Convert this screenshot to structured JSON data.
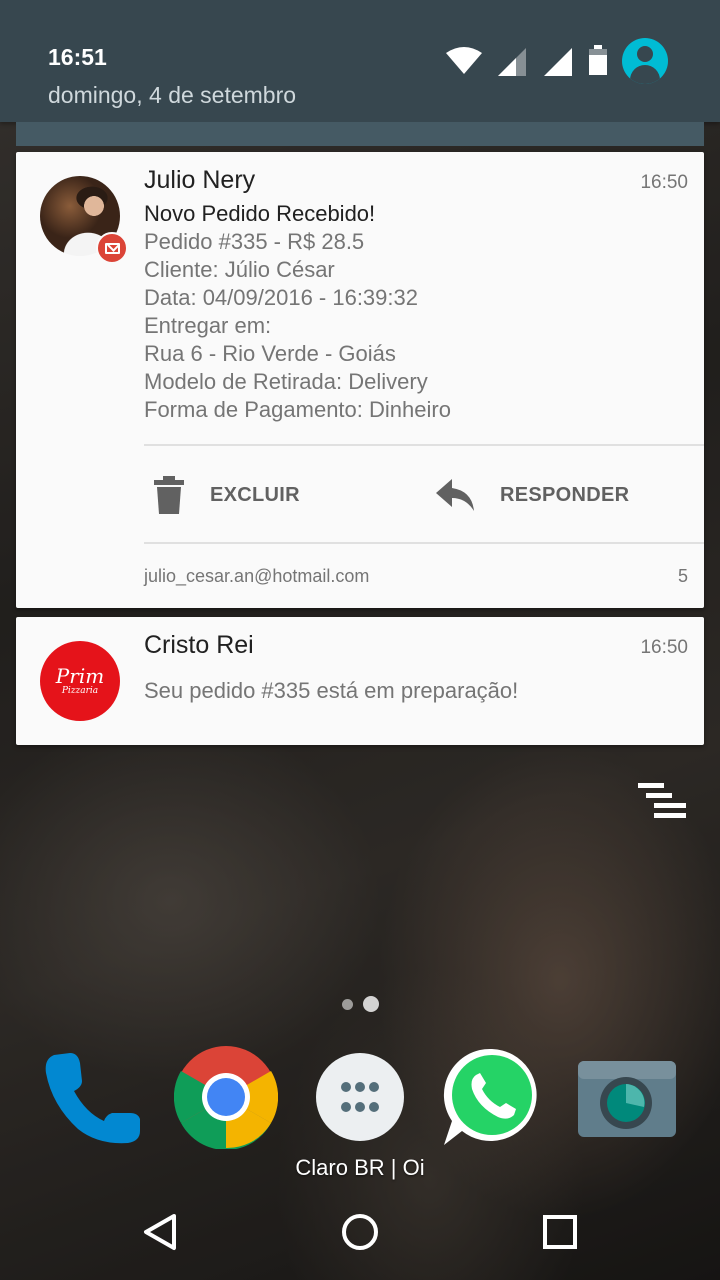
{
  "status_bar": {
    "time": "16:51",
    "date": "domingo, 4 de setembro",
    "icons": [
      "wifi-icon",
      "signal-icon",
      "signal-icon",
      "battery-icon",
      "account-icon"
    ]
  },
  "notifications": [
    {
      "app": "Gmail",
      "title": "Julio Nery",
      "time": "16:50",
      "lines": [
        "Novo Pedido Recebido!",
        "Pedido #335 - R$ 28.5",
        "Cliente: Júlio César",
        "Data: 04/09/2016 - 16:39:32",
        "Entregar em:",
        "Rua 6 - Rio Verde - Goiás",
        "Modelo de Retirada: Delivery",
        "Forma de Pagamento: Dinheiro"
      ],
      "actions": [
        {
          "label": "EXCLUIR",
          "icon": "trash-icon"
        },
        {
          "label": "RESPONDER",
          "icon": "reply-icon"
        }
      ],
      "account": "julio_cesar.an@hotmail.com",
      "count": "5"
    },
    {
      "title": "Cristo Rei",
      "time": "16:50",
      "text": "Seu pedido #335 está em preparação!",
      "logo_text": "Prim",
      "logo_subtext": "Pizzaria"
    }
  ],
  "home": {
    "dock_apps": [
      "Telefone",
      "Chrome",
      "Apps",
      "WhatsApp",
      "Câmera"
    ],
    "carrier": "Claro BR | Oi"
  },
  "colors": {
    "shade": "#37474f",
    "gmail_red": "#db4437",
    "pizzeria_red": "#e5131a",
    "whatsapp_green": "#25d366"
  }
}
